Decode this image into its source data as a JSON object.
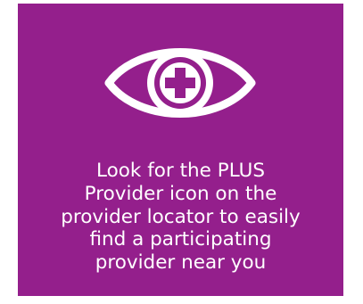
{
  "tile": {
    "background_color": "#941f8c",
    "icon": "eye-plus-icon",
    "caption_lines": [
      "Look for the PLUS",
      "Provider icon on the",
      "provider locator to easily",
      "find a participating",
      "provider near you"
    ]
  }
}
